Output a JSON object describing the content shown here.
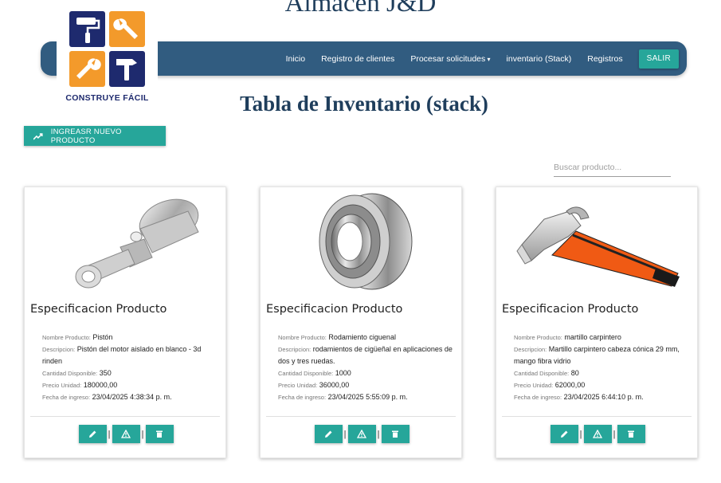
{
  "header": {
    "site_title": "Almacen J&D",
    "logo_text": "CONSTRUYE FÁCIL"
  },
  "nav": {
    "items": [
      "Inicio",
      "Registro de clientes",
      "Procesar solicitudes",
      "inventario (Stack)",
      "Registros"
    ],
    "logout_label": "SALIR"
  },
  "page": {
    "title": "Tabla de Inventario (stack)",
    "add_button_label": "INGREASR NUEVO PRODUCTO",
    "search_placeholder": "Buscar producto..."
  },
  "labels": {
    "card_title": "Especificacion Producto",
    "name": "Nombre Producto:",
    "description": "Descripcion:",
    "quantity": "Cantidad Disponible:",
    "price": "Precio Unidad:",
    "date": "Fecha de ingreso:"
  },
  "products": [
    {
      "image": "piston-image",
      "name": "Pistón",
      "description": "Pistón del motor aislado en blanco - 3d rinden",
      "quantity": "350",
      "price": "180000,00",
      "date": "23/04/2025 4:38:34 p. m."
    },
    {
      "image": "bearing-image",
      "name": "Rodamiento ciguenal",
      "description": "rodamientos de cigüeñal en aplicaciones de dos y tres ruedas.",
      "quantity": "1000",
      "price": "36000,00",
      "date": "23/04/2025 5:55:09 p. m."
    },
    {
      "image": "hammer-image",
      "name": "martillo carpintero",
      "description": "Martillo carpintero cabeza cónica 29 mm, mango fibra vidrio",
      "quantity": "80",
      "price": "62000,00",
      "date": "23/04/2025 6:44:10 p. m."
    }
  ],
  "colors": {
    "navbar": "#315c80",
    "accent": "#26a69a",
    "title": "#1f3e5c",
    "logo_blue": "#1e2a6e",
    "logo_orange": "#f39a2b"
  }
}
